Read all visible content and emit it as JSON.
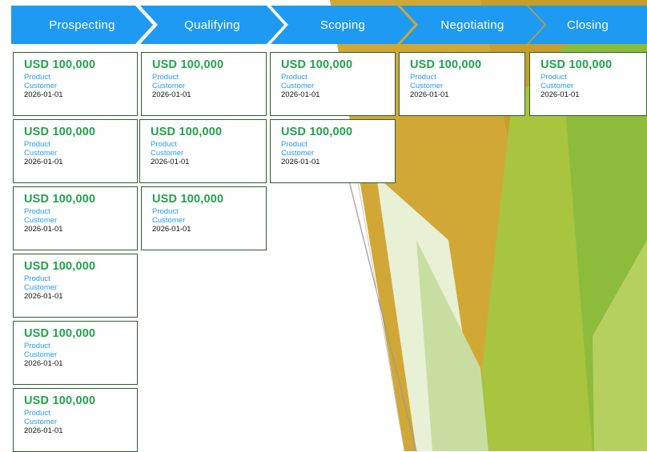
{
  "colors": {
    "stage_bg": "#1E9AF3",
    "stage_text": "#FFFFFF",
    "amount": "#1FA34A",
    "meta": "#1E9AF3",
    "card_border": "#2E5E2E"
  },
  "stages": [
    {
      "label": "Prospecting"
    },
    {
      "label": "Qualifying"
    },
    {
      "label": "Scoping"
    },
    {
      "label": "Negotiating"
    },
    {
      "label": "Closing"
    }
  ],
  "deals": {
    "prospecting": [
      {
        "amount": "USD 100,000",
        "product": "Product",
        "customer": "Customer",
        "date": "2026-01-01"
      },
      {
        "amount": "USD 100,000",
        "product": "Product",
        "customer": "Customer",
        "date": "2026-01-01"
      },
      {
        "amount": "USD 100,000",
        "product": "Product",
        "customer": "Customer",
        "date": "2026-01-01"
      },
      {
        "amount": "USD 100,000",
        "product": "Product",
        "customer": "Customer",
        "date": "2026-01-01"
      },
      {
        "amount": "USD 100,000",
        "product": "Product",
        "customer": "Customer",
        "date": "2026-01-01"
      },
      {
        "amount": "USD 100,000",
        "product": "Product",
        "customer": "Customer",
        "date": "2026-01-01"
      }
    ],
    "qualifying": [
      {
        "amount": "USD 100,000",
        "product": "Product",
        "customer": "Customer",
        "date": "2026-01-01"
      },
      {
        "amount": "USD 100,000",
        "product": "Product",
        "customer": "Customer",
        "date": "2026-01-01"
      },
      {
        "amount": "USD 100,000",
        "product": "Product",
        "customer": "Customer",
        "date": "2026-01-01"
      }
    ],
    "scoping": [
      {
        "amount": "USD 100,000",
        "product": "Product",
        "customer": "Customer",
        "date": "2026-01-01"
      },
      {
        "amount": "USD 100,000",
        "product": "Product",
        "customer": "Customer",
        "date": "2026-01-01"
      }
    ],
    "negotiating": [
      {
        "amount": "USD 100,000",
        "product": "Product",
        "customer": "Customer",
        "date": "2026-01-01"
      }
    ],
    "closing": [
      {
        "amount": "USD 100,000",
        "product": "Product",
        "customer": "Customer",
        "date": "2026-01-01"
      }
    ]
  }
}
